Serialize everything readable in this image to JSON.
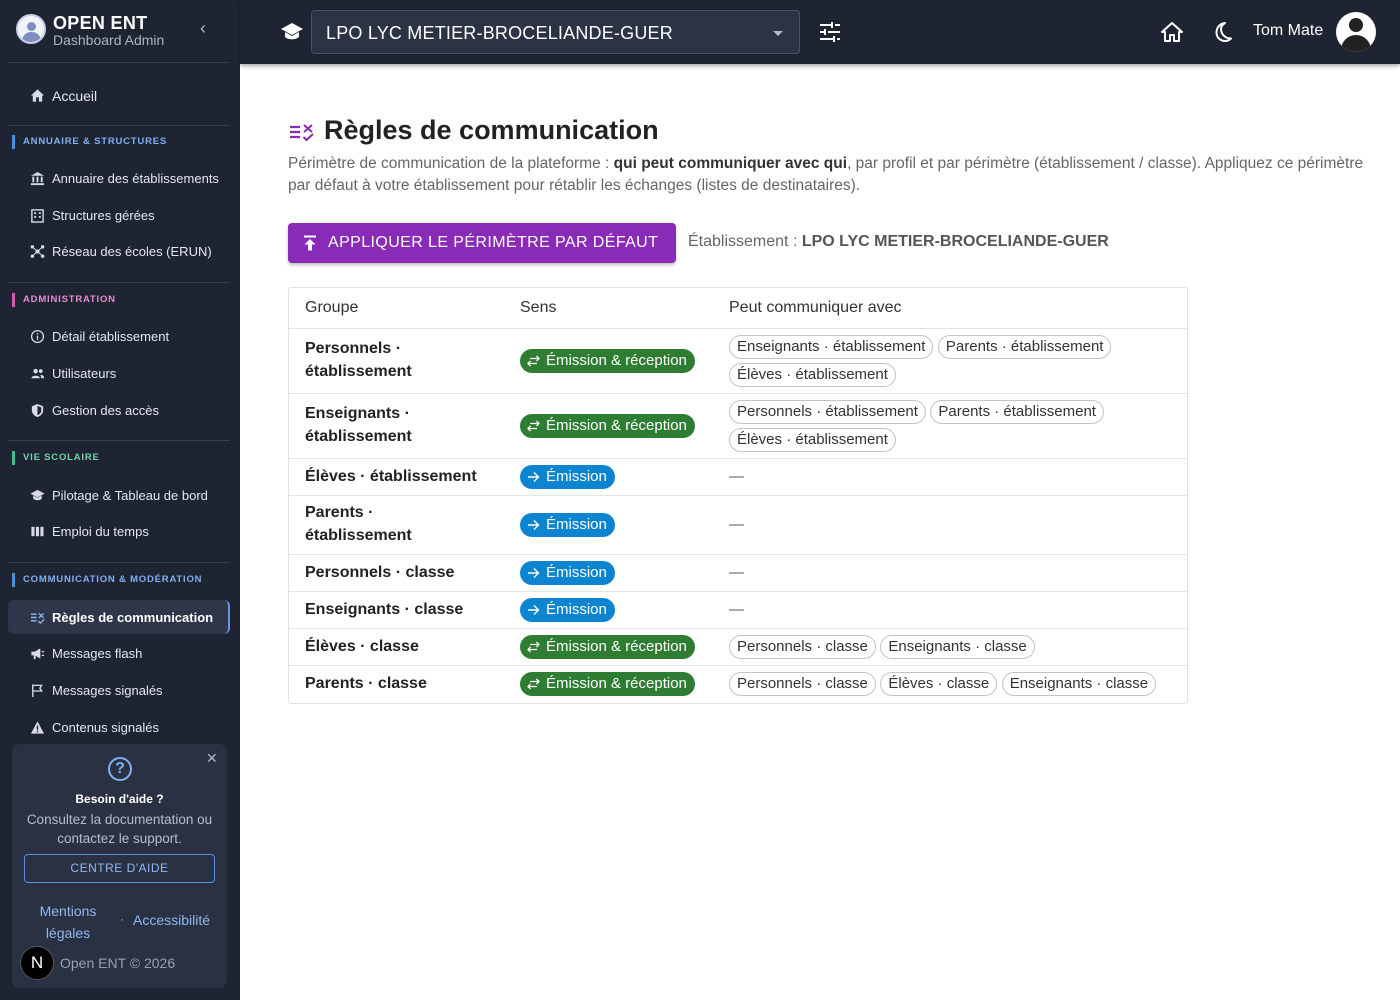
{
  "brand": {
    "title": "OPEN ENT",
    "subtitle": "Dashboard Admin"
  },
  "sidebar": {
    "home": "Accueil",
    "sections": [
      {
        "title": "ANNUAIRE & STRUCTURES",
        "items": [
          "Annuaire des établissements",
          "Structures gérées",
          "Réseau des écoles (ERUN)"
        ]
      },
      {
        "title": "ADMINISTRATION",
        "items": [
          "Détail établissement",
          "Utilisateurs",
          "Gestion des accès"
        ]
      },
      {
        "title": "VIE SCOLAIRE",
        "items": [
          "Pilotage & Tableau de bord",
          "Emploi du temps"
        ]
      },
      {
        "title": "COMMUNICATION & MODÉRATION",
        "items": [
          "Règles de communication",
          "Messages flash",
          "Messages signalés",
          "Contenus signalés"
        ]
      }
    ]
  },
  "help": {
    "title": "Besoin d'aide ?",
    "text": "Consultez la documentation ou contactez le support.",
    "button": "CENTRE D'AIDE",
    "link_legal": "Mentions légales",
    "separator": "·",
    "link_access": "Accessibilité",
    "logo_letter": "N",
    "copyright": "Open ENT © 2026"
  },
  "topbar": {
    "establishment": "LPO LYC METIER-BROCELIANDE-GUER",
    "user_name": "Tom Mate"
  },
  "page": {
    "title": "Règles de communication",
    "intro_start": "Périmètre de communication de la plateforme : ",
    "intro_bold": "qui peut communiquer avec qui",
    "intro_end": ", par profil et par périmètre (établissement / classe). Appliquez ce périmètre par défaut à votre établissement pour rétablir les échanges (listes de destinataires).",
    "apply_button": "APPLIQUER LE PÉRIMÈTRE PAR DÉFAUT",
    "etab_prefix": "Établissement : ",
    "etab_name": "LPO LYC METIER-BROCELIANDE-GUER"
  },
  "table": {
    "headers": [
      "Groupe",
      "Sens",
      "Peut communiquer avec"
    ],
    "rows": [
      {
        "group": "Personnels · établissement",
        "sens": "Émission & réception",
        "type": "both",
        "targets": [
          "Enseignants · établissement",
          "Parents · établissement",
          "Élèves · établissement"
        ]
      },
      {
        "group": "Enseignants · établissement",
        "sens": "Émission & réception",
        "type": "both",
        "targets": [
          "Personnels · établissement",
          "Parents · établissement",
          "Élèves · établissement"
        ]
      },
      {
        "group": "Élèves · établissement",
        "sens": "Émission",
        "type": "emit",
        "targets": [],
        "empty": "—"
      },
      {
        "group": "Parents · établissement",
        "sens": "Émission",
        "type": "emit",
        "targets": [],
        "empty": "—"
      },
      {
        "group": "Personnels · classe",
        "sens": "Émission",
        "type": "emit",
        "targets": [],
        "empty": "—"
      },
      {
        "group": "Enseignants · classe",
        "sens": "Émission",
        "type": "emit",
        "targets": [],
        "empty": "—"
      },
      {
        "group": "Élèves · classe",
        "sens": "Émission & réception",
        "type": "both",
        "targets": [
          "Personnels · classe",
          "Enseignants · classe"
        ]
      },
      {
        "group": "Parents · classe",
        "sens": "Émission & réception",
        "type": "both",
        "targets": [
          "Personnels · classe",
          "Élèves · classe",
          "Enseignants · classe"
        ]
      }
    ]
  },
  "colors": {
    "sidebar": "#1f2433",
    "accent": "#8a2bb8",
    "both_badge": "#2e7d32",
    "emit_badge": "#0c84d0"
  },
  "icons": [
    "home-icon",
    "building-icon",
    "structure-icon",
    "network-icon",
    "info-icon",
    "users-icon",
    "shield-icon",
    "school-icon",
    "calendar-icon",
    "rules-icon",
    "megaphone-icon",
    "flag-icon",
    "warning-icon",
    "help-icon",
    "tune-icon",
    "moon-icon",
    "upload-icon",
    "swap-icon",
    "arrow-right-icon"
  ]
}
